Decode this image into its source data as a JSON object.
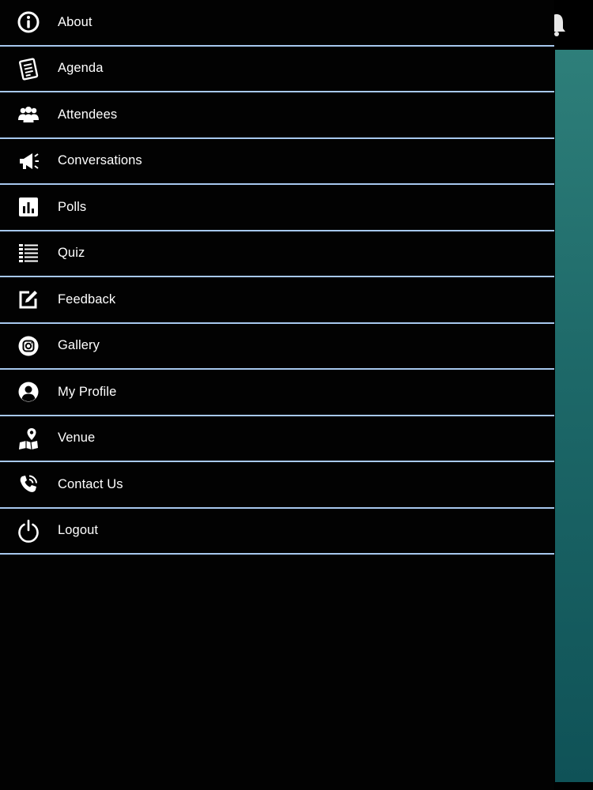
{
  "menu": {
    "items": [
      {
        "label": "About",
        "icon": "info-icon"
      },
      {
        "label": "Agenda",
        "icon": "agenda-icon"
      },
      {
        "label": "Attendees",
        "icon": "attendees-icon"
      },
      {
        "label": "Conversations",
        "icon": "megaphone-icon"
      },
      {
        "label": "Polls",
        "icon": "polls-chart-icon"
      },
      {
        "label": "Quiz",
        "icon": "quiz-list-icon"
      },
      {
        "label": "Feedback",
        "icon": "feedback-edit-icon"
      },
      {
        "label": "Gallery",
        "icon": "gallery-camera-icon"
      },
      {
        "label": "My Profile",
        "icon": "profile-icon"
      },
      {
        "label": "Venue",
        "icon": "venue-map-pin-icon"
      },
      {
        "label": "Contact Us",
        "icon": "phone-icon"
      },
      {
        "label": "Logout",
        "icon": "power-icon"
      }
    ]
  },
  "colors": {
    "drawer_background": "#020202",
    "divider": "#a7c8ee",
    "text": "#ffffff",
    "app_accent": "#1d6868"
  },
  "background_app": {
    "notification_icon": "bell-icon"
  }
}
